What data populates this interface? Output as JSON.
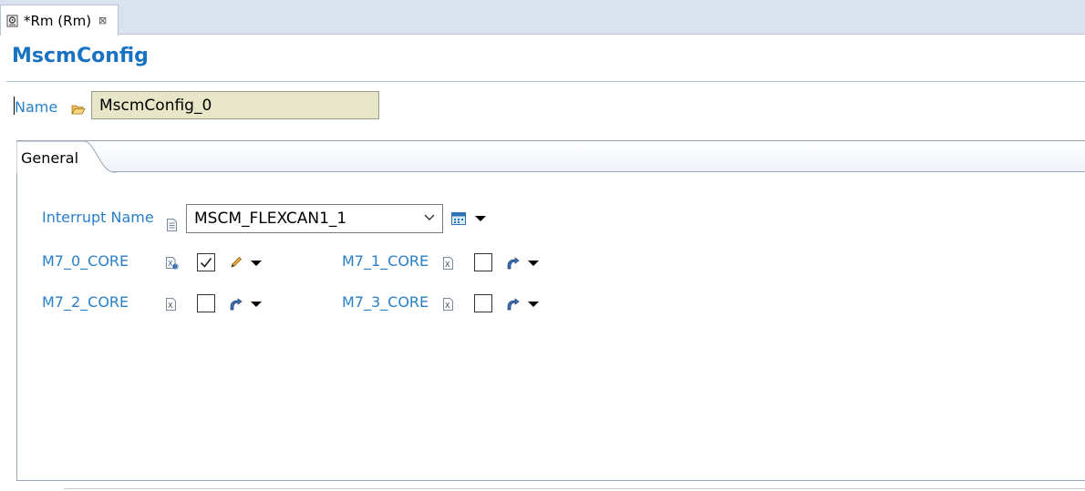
{
  "editor_tab": {
    "title": "*Rm (Rm)",
    "close": "⊠"
  },
  "page": {
    "title": "MscmConfig"
  },
  "name_field": {
    "label": "Name",
    "value": "MscmConfig_0"
  },
  "panel": {
    "tab_label": "General"
  },
  "interrupt": {
    "label": "Interrupt Name",
    "selected": "MSCM_FLEXCAN1_1"
  },
  "cores": [
    {
      "label": "M7_0_CORE",
      "checked": true
    },
    {
      "label": "M7_1_CORE",
      "checked": false
    },
    {
      "label": "M7_2_CORE",
      "checked": false
    },
    {
      "label": "M7_3_CORE",
      "checked": false
    }
  ],
  "colors": {
    "accent": "#1a73c2",
    "label": "#2a7fc9",
    "name_bg": "#e7e6c8"
  }
}
